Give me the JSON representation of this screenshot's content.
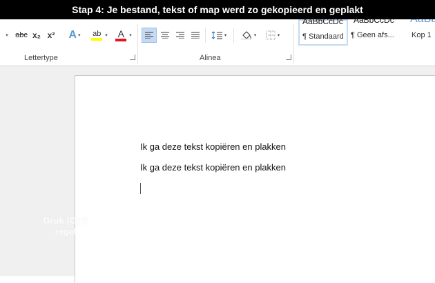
{
  "banner": {
    "text": "Stap 4: Je bestand, tekst of map werd zo gekopieerd en geplakt"
  },
  "ribbon": {
    "font_group": {
      "label": "Lettertype",
      "buttons": [
        "abc",
        "x₂",
        "x²",
        "A",
        "ab",
        "A"
      ],
      "highlight_color": "#ffff00",
      "font_color": "#e81123"
    },
    "paragraph_group": {
      "label": "Alinea"
    },
    "styles": {
      "items": [
        {
          "sample": "AaBbCcDc",
          "name": "¶ Standaard"
        },
        {
          "sample": "AaBbCcDc",
          "name": "¶ Geen afs..."
        },
        {
          "sample": "AaBbC",
          "name": "Kop 1"
        }
      ]
    }
  },
  "document": {
    "lines": [
      "Ik ga deze tekst kopiëren en plakken",
      "Ik ga deze tekst kopiëren en plakken"
    ]
  },
  "overlay": {
    "line1": "Gruk (Ctrl)",
    "line2": "regel"
  }
}
